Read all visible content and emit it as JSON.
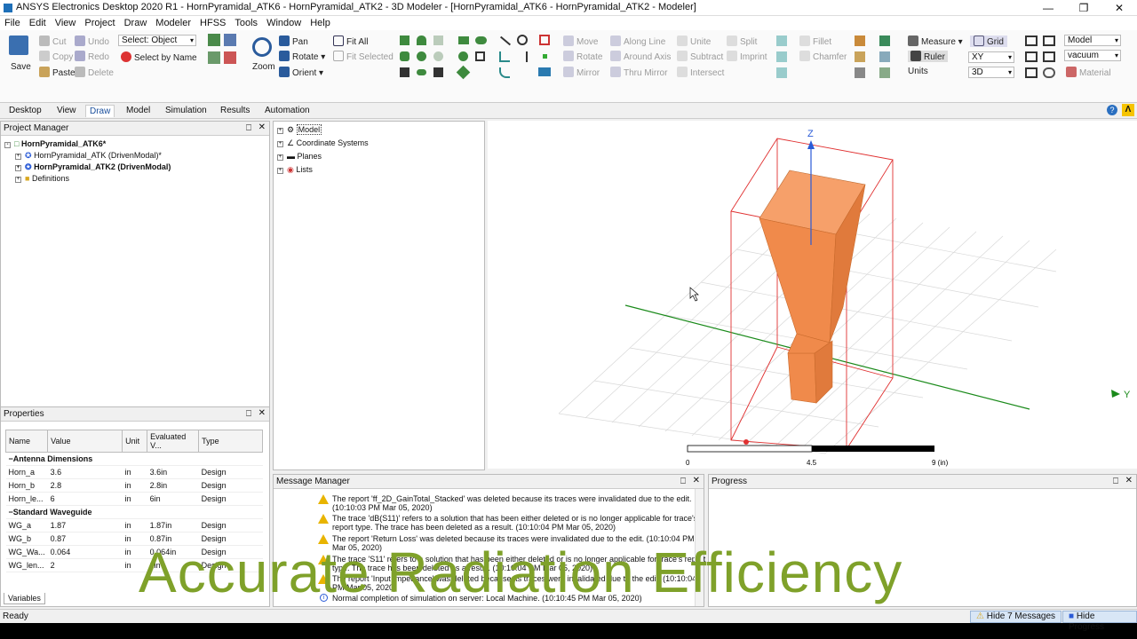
{
  "window": {
    "title": "ANSYS Electronics Desktop 2020 R1 - HornPyramidal_ATK6 - HornPyramidal_ATK2 - 3D Modeler - [HornPyramidal_ATK6 - HornPyramidal_ATK2 - Modeler]"
  },
  "menu": [
    "File",
    "Edit",
    "View",
    "Project",
    "Draw",
    "Modeler",
    "HFSS",
    "Tools",
    "Window",
    "Help"
  ],
  "ribbon": {
    "save": "Save",
    "cut": "Cut",
    "copy": "Copy",
    "paste": "Paste",
    "undo": "Undo",
    "redo": "Redo",
    "delete": "Delete",
    "select_value": "Select: Object",
    "select_by_name": "Select by Name",
    "zoom": "Zoom",
    "pan": "Pan",
    "rotate": "Rotate",
    "orient": "Orient",
    "fit_all": "Fit All",
    "fit_selected": "Fit Selected",
    "move": "Move",
    "rotate2": "Rotate",
    "mirror": "Mirror",
    "along_axis": "Along Line",
    "around_axis": "Around Axis",
    "thru_mirror": "Thru Mirror",
    "unite": "Unite",
    "subtract": "Subtract",
    "intersect": "Intersect",
    "split": "Split",
    "imprint": "Imprint",
    "fillet": "Fillet",
    "chamfer": "Chamfer",
    "measure": "Measure",
    "ruler": "Ruler",
    "units": "Units",
    "grid": "Grid",
    "plane_value": "XY",
    "mode_value": "3D",
    "model_value": "Model",
    "material_value": "vacuum",
    "material": "Material"
  },
  "tabs": [
    "Desktop",
    "View",
    "Draw",
    "Model",
    "Simulation",
    "Results",
    "Automation"
  ],
  "active_tab": "Draw",
  "project_manager": {
    "title": "Project Manager",
    "root": "HornPyramidal_ATK6*",
    "children": [
      "HornPyramidal_ATK (DrivenModal)*",
      "HornPyramidal_ATK2 (DrivenModal)",
      "Definitions"
    ]
  },
  "model_tree": [
    "Model",
    "Coordinate Systems",
    "Planes",
    "Lists"
  ],
  "properties": {
    "title": "Properties",
    "columns": [
      "Name",
      "Value",
      "Unit",
      "Evaluated V...",
      "Type"
    ],
    "groups": [
      {
        "name": "Antenna Dimensions",
        "rows": [
          [
            "Horn_a",
            "3.6",
            "in",
            "3.6in",
            "Design"
          ],
          [
            "Horn_b",
            "2.8",
            "in",
            "2.8in",
            "Design"
          ],
          [
            "Horn_le...",
            "6",
            "in",
            "6in",
            "Design"
          ]
        ]
      },
      {
        "name": "Standard Waveguide",
        "rows": [
          [
            "WG_a",
            "1.87",
            "in",
            "1.87in",
            "Design"
          ],
          [
            "WG_b",
            "0.87",
            "in",
            "0.87in",
            "Design"
          ],
          [
            "WG_Wa...",
            "0.064",
            "in",
            "0.064in",
            "Design"
          ],
          [
            "WG_len...",
            "2",
            "in",
            "2in",
            "Design"
          ]
        ]
      }
    ],
    "tab": "Variables"
  },
  "viewport": {
    "axis_z": "Z",
    "axis_y": "Y",
    "scale_labels": [
      "0",
      "4.5",
      "9 (in)"
    ]
  },
  "message_manager": {
    "title": "Message Manager",
    "messages": [
      "The report 'ff_2D_GainTotal_Stacked' was deleted because its traces were invalidated due to the edit. (10:10:03 PM  Mar 05, 2020)",
      "The trace 'dB(S11)' refers to a solution that has been either deleted or is no longer applicable for trace's report type. The trace has been deleted as a result. (10:10:04 PM  Mar 05, 2020)",
      "The report 'Return Loss' was deleted because its traces were invalidated due to the edit. (10:10:04 PM  Mar 05, 2020)",
      "The trace 'S11' refers to a solution that has been either deleted or is no longer applicable for trace's report type. The trace has been deleted as a result. (10:10:04 PM  Mar 05, 2020)",
      "The report 'Input Impedance' was deleted because its traces were invalidated due to the edit. (10:10:04 PM  Mar 05, 2020)",
      "Normal completion of simulation on server: Local Machine. (10:10:45 PM  Mar 05, 2020)"
    ]
  },
  "progress": {
    "title": "Progress"
  },
  "status": {
    "ready": "Ready",
    "hide_messages": "Hide 7 Messages",
    "hide_progress": "Hide Progress"
  },
  "overlay_text": "Accurate Radiation Efficiency",
  "colors": {
    "horn": "#f08a4b",
    "overlay": "#7fa12a",
    "bbox": "#e03030",
    "yaxis": "#1a8a1a",
    "zaxis": "#2a5bd7"
  }
}
